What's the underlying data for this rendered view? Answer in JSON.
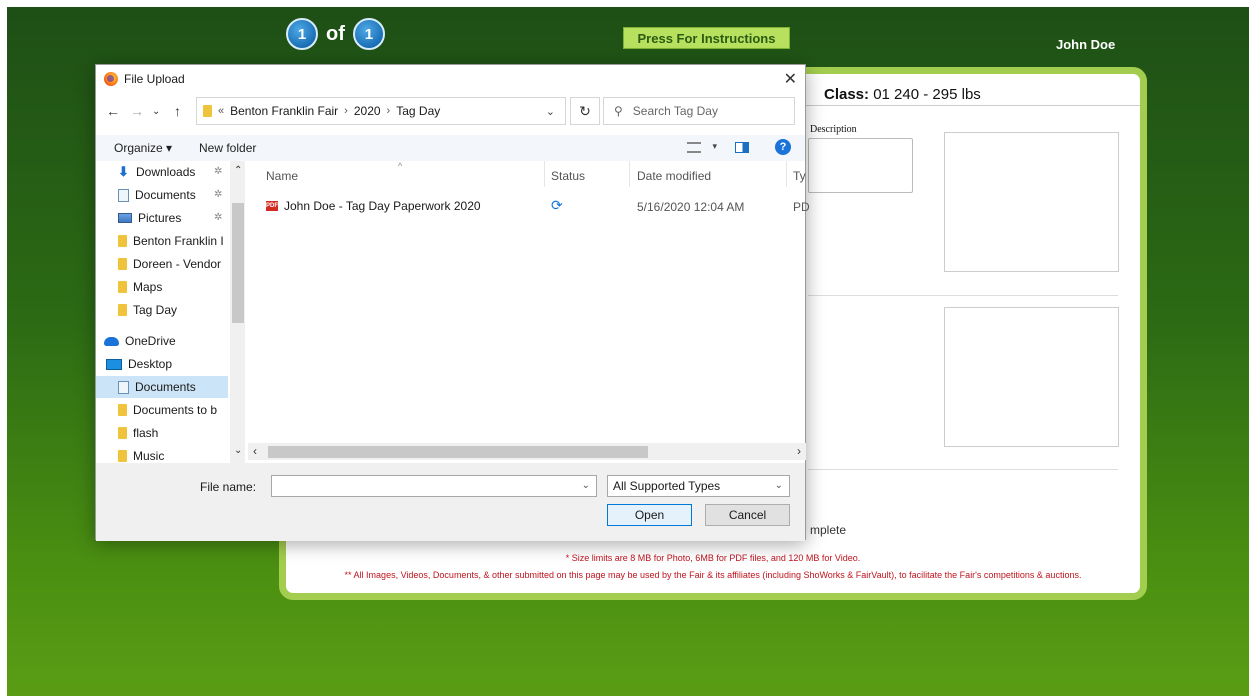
{
  "header": {
    "current_page": "1",
    "of_text": "of",
    "total_pages": "1",
    "instructions_button": "Press For Instructions",
    "user_name": "John Doe"
  },
  "panel": {
    "class_label": "Class:",
    "class_value": "01 240 - 295 lbs",
    "description_label": "Description",
    "status_partial": "mplete",
    "note_size_limits": "* Size limits are 8 MB for Photo, 6MB for PDF files, and 120 MB for Video.",
    "note_usage": "** All Images, Videos, Documents, & other submitted on this page may be used by the Fair & its affiliates (including ShoWorks & FairVault), to facilitate the Fair's competitions & auctions."
  },
  "dialog": {
    "title": "File Upload",
    "breadcrumb": [
      "Benton Franklin Fair",
      "2020",
      "Tag Day"
    ],
    "search_placeholder": "Search Tag Day",
    "toolbar": {
      "organize": "Organize",
      "new_folder": "New folder"
    },
    "sidebar": [
      {
        "label": "Downloads",
        "icon": "download-icon",
        "pinned": true
      },
      {
        "label": "Documents",
        "icon": "document-icon",
        "pinned": true
      },
      {
        "label": "Pictures",
        "icon": "pictures-icon",
        "pinned": true
      },
      {
        "label": "Benton Franklin I",
        "icon": "folder-icon"
      },
      {
        "label": "Doreen - Vendor",
        "icon": "folder-icon"
      },
      {
        "label": "Maps",
        "icon": "folder-icon"
      },
      {
        "label": "Tag Day",
        "icon": "folder-icon"
      },
      {
        "label": "OneDrive",
        "icon": "cloud-icon"
      },
      {
        "label": "Desktop",
        "icon": "desktop-icon"
      },
      {
        "label": "Documents",
        "icon": "document-icon",
        "selected": true
      },
      {
        "label": "Documents to b",
        "icon": "folder-icon"
      },
      {
        "label": "flash",
        "icon": "folder-icon"
      },
      {
        "label": "Music",
        "icon": "folder-icon"
      }
    ],
    "columns": {
      "name": "Name",
      "status": "Status",
      "date": "Date modified",
      "type": "Ty"
    },
    "files": [
      {
        "name": "John Doe - Tag Day Paperwork 2020",
        "date": "5/16/2020 12:04 AM",
        "type": "PD"
      }
    ],
    "file_name_label": "File name:",
    "file_name_value": "",
    "file_type": "All Supported Types",
    "open_label": "Open",
    "cancel_label": "Cancel"
  }
}
